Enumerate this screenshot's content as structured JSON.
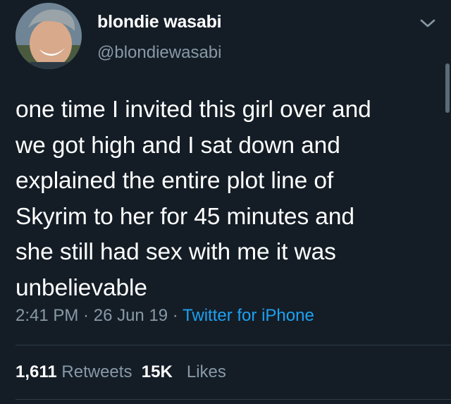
{
  "user": {
    "display_name": "blondie wasabi",
    "handle": "@blondiewasabi",
    "avatar_icon": "profile-photo-icon"
  },
  "tweet": {
    "lines": [
      "one time I invited this girl over and",
      "we got high and I sat down and",
      "explained the entire plot line of",
      "Skyrim to her for 45 minutes and",
      "she still had sex with me it was",
      "unbelievable"
    ],
    "time": "2:41 PM",
    "separator": " · ",
    "date": "26 Jun 19",
    "source": "Twitter for iPhone"
  },
  "stats": {
    "retweets_count": "1,611",
    "retweets_label": "Retweets",
    "likes_count": "15K",
    "likes_label": "Likes"
  },
  "colors": {
    "background": "#141d26",
    "primary_text": "#ffffff",
    "secondary_text": "#8899a6",
    "link": "#1da1f2",
    "divider": "#2f3b47"
  }
}
